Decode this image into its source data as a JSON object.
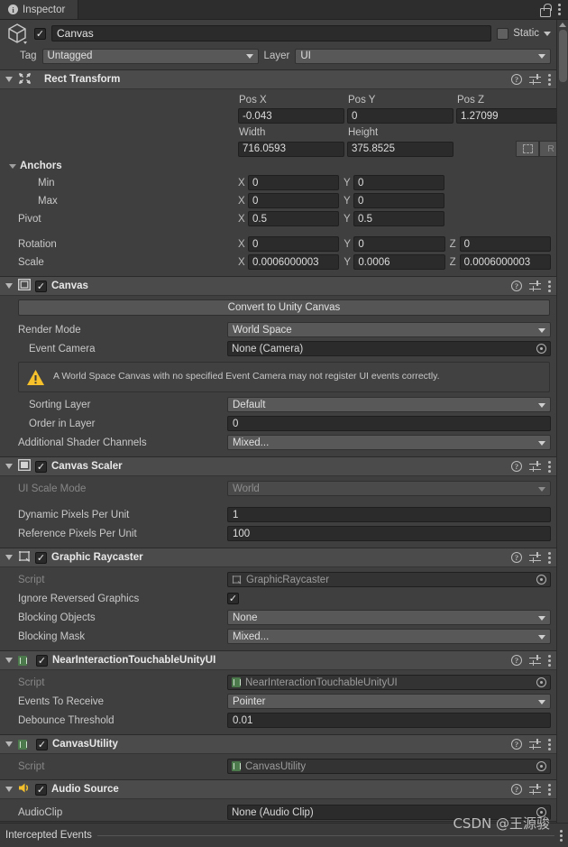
{
  "window": {
    "tab_label": "Inspector",
    "tab_icon": "info-icon",
    "lock_icon": "lock-open-icon",
    "menu_icon": "kebab-menu-icon"
  },
  "object_header": {
    "icon": "cube-icon",
    "enabled": true,
    "name": "Canvas",
    "static_label": "Static",
    "static_checked": false,
    "tag_label": "Tag",
    "tag_value": "Untagged",
    "layer_label": "Layer",
    "layer_value": "UI"
  },
  "header_icons": {
    "help": "?",
    "preset": "preset-icon",
    "menu": "kebab-menu-icon"
  },
  "components": [
    {
      "id": "rect-transform",
      "title": "Rect Transform",
      "icon": "rect-transform-icon",
      "has_checkbox": false,
      "pos_labels": [
        "Pos X",
        "Pos Y",
        "Pos Z"
      ],
      "pos_values": [
        "-0.043",
        "0",
        "1.27099"
      ],
      "size_labels": [
        "Width",
        "Height"
      ],
      "size_values": [
        "716.0593",
        "375.8525"
      ],
      "blueprint_button": "blueprint-mode",
      "raw_button": "R",
      "anchors_title": "Anchors",
      "rows": [
        {
          "label": "Min",
          "indent": true,
          "axes": [
            "X",
            "Y"
          ],
          "values": [
            "0",
            "0"
          ]
        },
        {
          "label": "Max",
          "indent": true,
          "axes": [
            "X",
            "Y"
          ],
          "values": [
            "0",
            "0"
          ]
        },
        {
          "label": "Pivot",
          "indent": false,
          "axes": [
            "X",
            "Y"
          ],
          "values": [
            "0.5",
            "0.5"
          ]
        },
        {
          "label": "Rotation",
          "indent": false,
          "axes": [
            "X",
            "Y",
            "Z"
          ],
          "values": [
            "0",
            "0",
            "0"
          ]
        },
        {
          "label": "Scale",
          "indent": false,
          "axes": [
            "X",
            "Y",
            "Z"
          ],
          "values": [
            "0.0006000003",
            "0.0006",
            "0.0006000003"
          ]
        }
      ]
    },
    {
      "id": "canvas",
      "title": "Canvas",
      "icon": "canvas-icon",
      "has_checkbox": true,
      "enabled": true,
      "convert_button": "Convert to Unity Canvas",
      "render_mode_label": "Render Mode",
      "render_mode_value": "World Space",
      "event_camera_label": "Event Camera",
      "event_camera_value": "None (Camera)",
      "warning_icon": "warning-triangle-icon",
      "warning_text": "A World Space Canvas with no specified Event Camera may not register UI events correctly.",
      "sorting_layer_label": "Sorting Layer",
      "sorting_layer_value": "Default",
      "order_in_layer_label": "Order in Layer",
      "order_in_layer_value": "0",
      "shader_channels_label": "Additional Shader Channels",
      "shader_channels_value": "Mixed..."
    },
    {
      "id": "canvas-scaler",
      "title": "Canvas Scaler",
      "icon": "canvas-scaler-icon",
      "has_checkbox": true,
      "enabled": true,
      "ui_scale_mode_label": "UI Scale Mode",
      "ui_scale_mode_value": "World",
      "dynamic_ppu_label": "Dynamic Pixels Per Unit",
      "dynamic_ppu_value": "1",
      "reference_ppu_label": "Reference Pixels Per Unit",
      "reference_ppu_value": "100"
    },
    {
      "id": "graphic-raycaster",
      "title": "Graphic Raycaster",
      "icon": "graphic-raycaster-icon",
      "has_checkbox": true,
      "enabled": true,
      "script_label": "Script",
      "script_value": "GraphicRaycaster",
      "ignore_reversed_label": "Ignore Reversed Graphics",
      "ignore_reversed_checked": true,
      "blocking_objects_label": "Blocking Objects",
      "blocking_objects_value": "None",
      "blocking_mask_label": "Blocking Mask",
      "blocking_mask_value": "Mixed..."
    },
    {
      "id": "near-interaction-touchable",
      "title": "NearInteractionTouchableUnityUI",
      "icon": "script-icon",
      "has_checkbox": true,
      "enabled": true,
      "script_label": "Script",
      "script_value": "NearInteractionTouchableUnityUI",
      "events_label": "Events To Receive",
      "events_value": "Pointer",
      "debounce_label": "Debounce Threshold",
      "debounce_value": "0.01"
    },
    {
      "id": "canvas-utility",
      "title": "CanvasUtility",
      "icon": "script-icon",
      "has_checkbox": true,
      "enabled": true,
      "script_label": "Script",
      "script_value": "CanvasUtility"
    },
    {
      "id": "audio-source",
      "title": "Audio Source",
      "icon": "audio-source-icon",
      "has_checkbox": true,
      "enabled": true,
      "audioclip_label": "AudioClip",
      "audioclip_value": "None (Audio Clip)"
    }
  ],
  "footer": {
    "title": "Intercepted Events",
    "menu_icon": "kebab-menu-icon"
  },
  "watermark": "CSDN @王源骏",
  "colors": {
    "panel_bg": "#383838",
    "component_header": "#4b4b4b",
    "field_bg": "#2b2b2b",
    "dropdown_bg": "#585858",
    "warning_yellow": "#f6c12b",
    "script_green": "#4c7a4c"
  }
}
